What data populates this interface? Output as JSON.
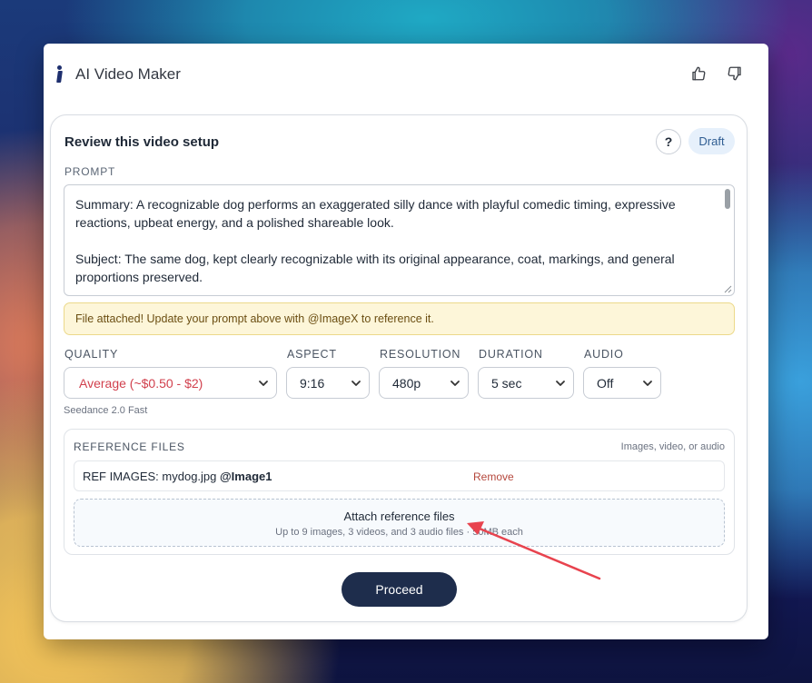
{
  "app": {
    "title": "AI Video Maker"
  },
  "header": {
    "icons": [
      "thumbs-up-icon",
      "thumbs-down-icon"
    ]
  },
  "card": {
    "title": "Review this video setup",
    "help_label": "?",
    "status_badge": "Draft"
  },
  "prompt": {
    "label": "PROMPT",
    "value": "Summary: A recognizable dog performs an exaggerated silly dance with playful comedic timing, expressive\nreactions, upbeat energy, and a polished shareable look.\n\nSubject: The same dog, kept clearly recognizable with its original appearance, coat, markings, and general\nproportions preserved."
  },
  "notice": {
    "text": "File attached! Update your prompt above with @ImageX to reference it."
  },
  "settings": {
    "quality": {
      "label": "QUALITY",
      "value": "Average (~$0.50 - $2)"
    },
    "aspect": {
      "label": "ASPECT",
      "value": "9:16"
    },
    "resolution": {
      "label": "RESOLUTION",
      "value": "480p"
    },
    "duration": {
      "label": "DURATION",
      "value": "5 sec"
    },
    "audio": {
      "label": "AUDIO",
      "value": "Off"
    },
    "model": "Seedance 2.0 Fast"
  },
  "reference": {
    "title": "REFERENCE FILES",
    "hint": "Images, video, or audio",
    "item": {
      "prefix": "REF IMAGES: mydog.jpg ",
      "tag": "@Image1",
      "remove_label": "Remove"
    },
    "attach": {
      "title": "Attach reference files",
      "subtitle": "Up to 9 images, 3 videos, and 3 audio files · 50MB each"
    }
  },
  "actions": {
    "proceed_label": "Proceed"
  },
  "colors": {
    "accent_dark": "#1e2d4c",
    "quality_text": "#d1404d",
    "annotation_arrow": "#e8434e",
    "notice_bg": "#fdf6d9"
  }
}
